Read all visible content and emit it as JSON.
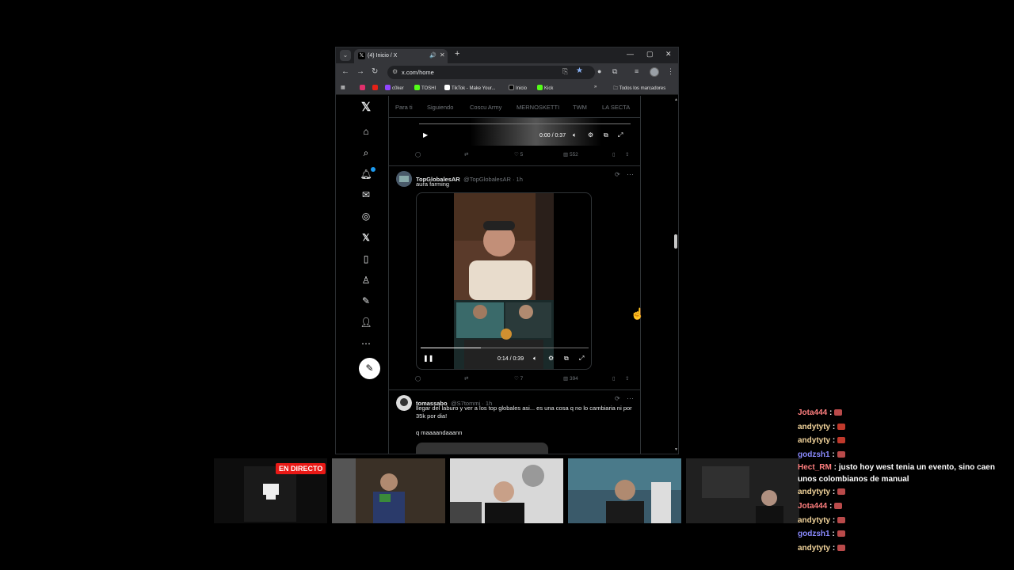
{
  "browser": {
    "tab_title": "(4) Inicio / X",
    "url": "x.com/home",
    "bookmarks": [
      {
        "label": "",
        "color": "#e1306c"
      },
      {
        "label": "",
        "color": "#e62117"
      },
      {
        "label": "c0ker",
        "color": "#9146ff"
      },
      {
        "label": "TOSHI",
        "color": "#53fc18"
      },
      {
        "label": "TikTok - Make Your...",
        "color": "#ffffff"
      },
      {
        "label": "Inicio",
        "color": "#000000"
      },
      {
        "label": "Kick",
        "color": "#53fc18"
      }
    ],
    "all_bookmarks": "Todos los marcadores"
  },
  "x": {
    "tabs": [
      "Para ti",
      "Siguiendo",
      "Coscu Army",
      "MERNOSKETTI",
      "TWM",
      "LA SECTA"
    ],
    "nav_icons": [
      "x-logo-icon",
      "home-icon",
      "search-icon",
      "bell-icon",
      "mail-icon",
      "grok-icon",
      "premium-icon",
      "bookmark-icon",
      "jobs-icon",
      "article-icon",
      "profile-icon",
      "more-icon",
      "compose-icon"
    ],
    "first_video": {
      "time": "0:00 / 0:37",
      "replies": "",
      "reposts": "",
      "likes": "5",
      "views": "552"
    },
    "tweet1": {
      "name": "TopGlobalesAR",
      "handle": "@TopGlobalesAR · 1h",
      "text": "aura farming",
      "video_time": "0:14 / 0:39",
      "video_progress": 0.36,
      "likes": "7",
      "views": "394"
    },
    "tweet2": {
      "name": "tomassabo",
      "handle": "@S7tommi · 1h",
      "text": "llegar del laburo y ver a los top globales asi... es una cosa q no lo cambiaria ni por 35k por dia!",
      "text2": "q maaaandaaann"
    }
  },
  "stream": {
    "live_badge": "EN DIRECTO",
    "chat": [
      {
        "user": "Jota444",
        "color": "#ff7f7f",
        "msg": ""
      },
      {
        "user": "andytyty",
        "color": "#f2d49b",
        "msg": ""
      },
      {
        "user": "andytyty",
        "color": "#f2d49b",
        "msg": ""
      },
      {
        "user": "godzsh1",
        "color": "#8a8aff",
        "msg": ""
      },
      {
        "user": "Hect_RM",
        "color": "#ff7f7f",
        "msg": "justo hoy west tenia un evento, sino caen unos colombianos de manual"
      },
      {
        "user": "andytyty",
        "color": "#f2d49b",
        "msg": ""
      },
      {
        "user": "Jota444",
        "color": "#ff7f7f",
        "msg": ""
      },
      {
        "user": "andytyty",
        "color": "#f2d49b",
        "msg": ""
      },
      {
        "user": "godzsh1",
        "color": "#8a8aff",
        "msg": ""
      },
      {
        "user": "andytyty",
        "color": "#f2d49b",
        "msg": ""
      }
    ]
  }
}
